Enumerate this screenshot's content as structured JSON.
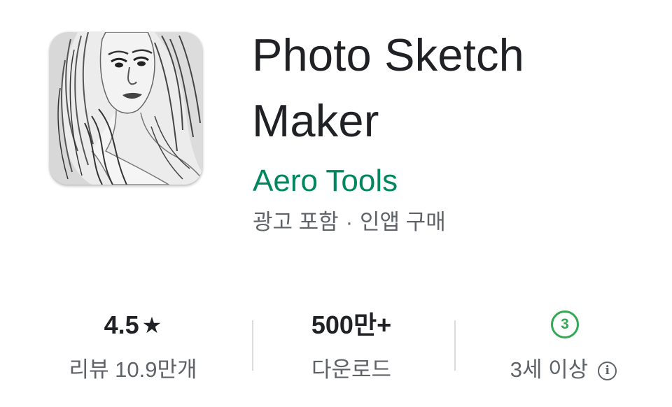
{
  "app": {
    "title": "Photo Sketch Maker",
    "developer": "Aero Tools",
    "meta_ads": "광고 포함",
    "meta_separator": "·",
    "meta_iap": "인앱 구매",
    "icon": "sketch-portrait-icon"
  },
  "stats": {
    "rating": {
      "value": "4.5",
      "star": "★",
      "label": "리뷰 10.9만개"
    },
    "downloads": {
      "value": "500만+",
      "label": "다운로드"
    },
    "age": {
      "badge": "3",
      "label": "3세 이상",
      "info_icon": "ⓘ"
    }
  },
  "colors": {
    "developer": "#01875f",
    "age_badge": "#34a853",
    "secondary_text": "#5f6368"
  }
}
